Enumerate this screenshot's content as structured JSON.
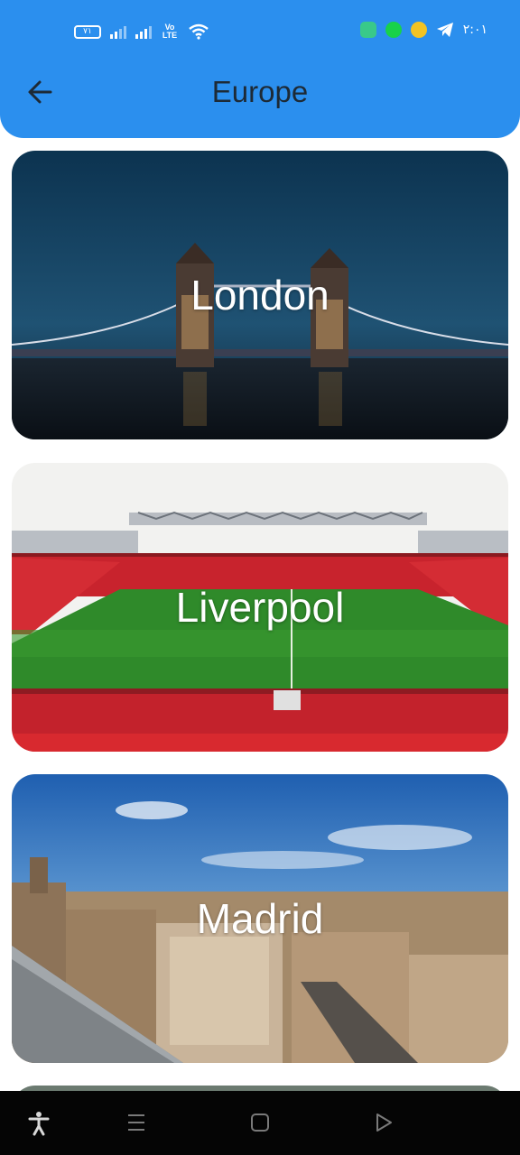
{
  "status_bar": {
    "battery": "٧١",
    "network": "Vo LTE",
    "time": "٢:٠١"
  },
  "header": {
    "title": "Europe",
    "back_icon": "arrow-left-icon"
  },
  "cities": [
    {
      "name": "London"
    },
    {
      "name": "Liverpool"
    },
    {
      "name": "Madrid"
    }
  ],
  "colors": {
    "appbar": "#2b8fee",
    "title_text": "#1d2a36",
    "card_label": "#ffffff",
    "nav_bar": "#050505"
  }
}
